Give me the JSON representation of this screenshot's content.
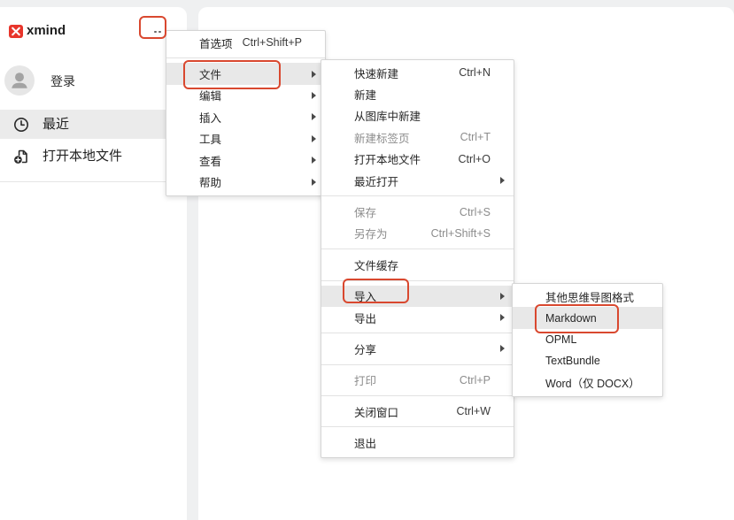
{
  "colors": {
    "page_background": "#eff0f1",
    "panel": "#ffffff",
    "text": "#262626",
    "disabled_text": "#8c8c8c",
    "hover": "#e8e8e8",
    "annotation": "#d9482f",
    "logo": "#e8352b"
  },
  "header": {
    "logo_text": "xmind",
    "logo_icon": "xmind-logo-icon",
    "more_icon": "more-icon"
  },
  "sidebar": {
    "account": {
      "label": "登录",
      "icon": "avatar-icon"
    },
    "items": [
      {
        "label": "最近",
        "icon": "clock-icon",
        "active": true
      },
      {
        "label": "打开本地文件",
        "icon": "file-add-icon",
        "active": false
      }
    ]
  },
  "submenu_icon": "triangle-right-icon",
  "menus": {
    "main": [
      {
        "label": "首选项",
        "shortcut": "Ctrl+Shift+P"
      },
      {
        "label": "文件",
        "submenu": true,
        "highlighted": true
      },
      {
        "label": "编辑",
        "submenu": true
      },
      {
        "label": "插入",
        "submenu": true
      },
      {
        "label": "工具",
        "submenu": true
      },
      {
        "label": "查看",
        "submenu": true
      },
      {
        "label": "帮助",
        "submenu": true
      }
    ],
    "file": [
      {
        "label": "快速新建",
        "shortcut": "Ctrl+N"
      },
      {
        "label": "新建"
      },
      {
        "label": "从图库中新建"
      },
      {
        "label": "新建标签页",
        "shortcut": "Ctrl+T",
        "disabled": true
      },
      {
        "label": "打开本地文件",
        "shortcut": "Ctrl+O"
      },
      {
        "label": "最近打开",
        "submenu": true
      },
      {
        "label": "保存",
        "shortcut": "Ctrl+S",
        "disabled": true
      },
      {
        "label": "另存为",
        "shortcut": "Ctrl+Shift+S",
        "disabled": true
      },
      {
        "label": "文件缓存"
      },
      {
        "label": "导入",
        "submenu": true,
        "highlighted": true
      },
      {
        "label": "导出",
        "submenu": true
      },
      {
        "label": "分享",
        "submenu": true
      },
      {
        "label": "打印",
        "shortcut": "Ctrl+P",
        "disabled": true
      },
      {
        "label": "关闭窗口",
        "shortcut": "Ctrl+W"
      },
      {
        "label": "退出"
      }
    ],
    "import": [
      {
        "label": "其他思维导图格式"
      },
      {
        "label": "Markdown",
        "highlighted": true
      },
      {
        "label": "OPML"
      },
      {
        "label": "TextBundle"
      },
      {
        "label": "Word（仅 DOCX）"
      }
    ]
  }
}
